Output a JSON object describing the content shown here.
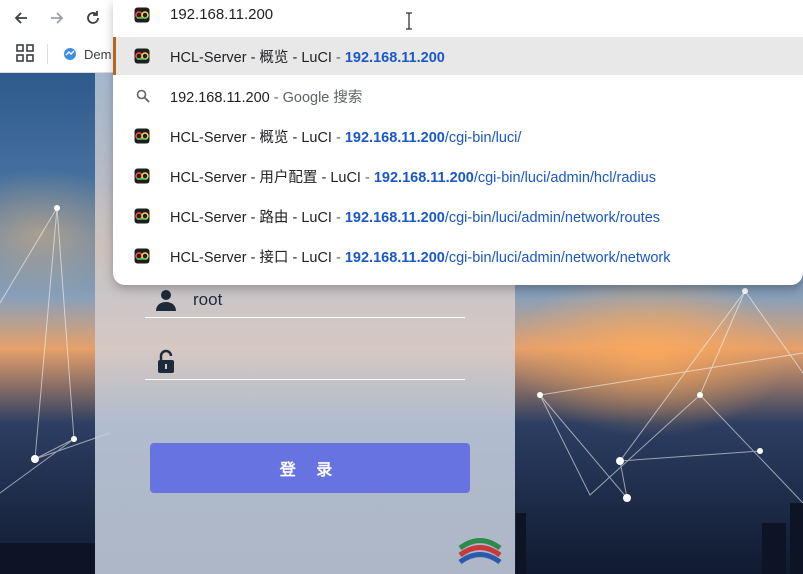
{
  "toolbar": {
    "back_icon": "arrow-left-icon",
    "forward_icon": "arrow-right-icon",
    "reload_icon": "reload-icon"
  },
  "bookmarks": {
    "items": [
      {
        "label": "Dem"
      }
    ]
  },
  "omnibox": {
    "input_value": "192.168.11.200",
    "suggestions": [
      {
        "type": "history",
        "title": "HCL-Server - 概览 - LuCI",
        "sep": " - ",
        "host": "192.168.11.200",
        "path": ""
      },
      {
        "type": "search",
        "query": "192.168.11.200",
        "suffix": " - Google 搜索"
      },
      {
        "type": "history",
        "title": "HCL-Server - 概览 - LuCI",
        "sep": " - ",
        "host": "192.168.11.200",
        "path": "/cgi-bin/luci/"
      },
      {
        "type": "history",
        "title": "HCL-Server - 用户配置 - LuCI",
        "sep": " - ",
        "host": "192.168.11.200",
        "path": "/cgi-bin/luci/admin/hcl/radius"
      },
      {
        "type": "history",
        "title": "HCL-Server - 路由 - LuCI",
        "sep": " - ",
        "host": "192.168.11.200",
        "path": "/cgi-bin/luci/admin/network/routes"
      },
      {
        "type": "history",
        "title": "HCL-Server - 接口 - LuCI",
        "sep": " - ",
        "host": "192.168.11.200",
        "path": "/cgi-bin/luci/admin/network/network"
      }
    ]
  },
  "login": {
    "username_value": "root",
    "password_value": "",
    "submit_label": "登 录"
  },
  "colors": {
    "accent": "#6673e0",
    "link": "#1a58c9",
    "selected_row": "#e8e8e8"
  }
}
